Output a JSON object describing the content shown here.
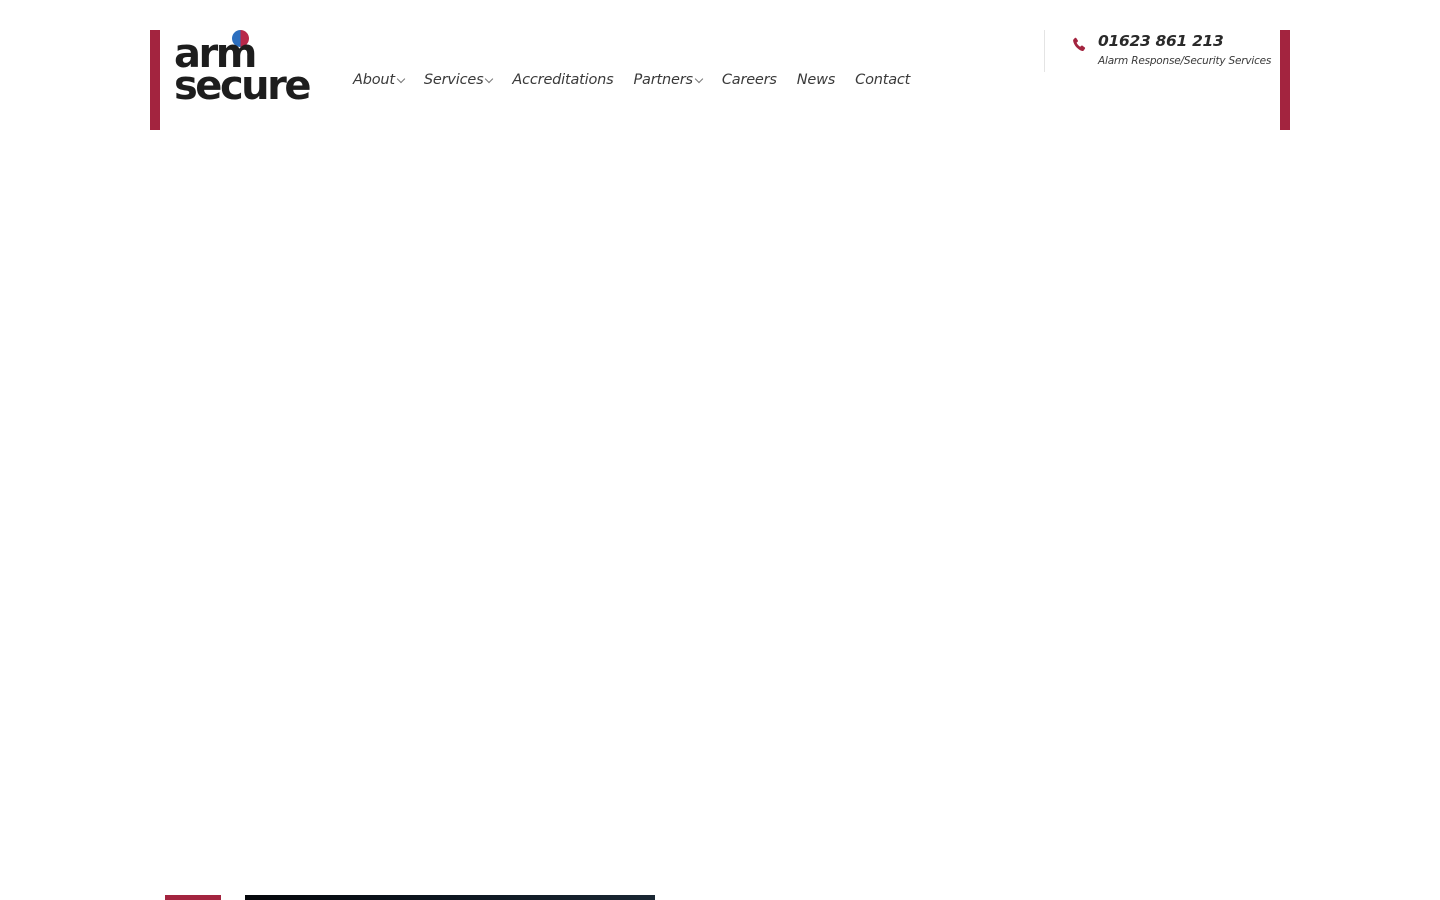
{
  "brand": {
    "logo_line1": "arm",
    "logo_line2": "secure",
    "accent_color": "#a3243f",
    "dot_colors": [
      "#2d6fbf",
      "#b8284a"
    ]
  },
  "nav": {
    "items": [
      {
        "label": "About",
        "has_dropdown": true
      },
      {
        "label": "Services",
        "has_dropdown": true
      },
      {
        "label": "Accreditations",
        "has_dropdown": false
      },
      {
        "label": "Partners",
        "has_dropdown": true
      },
      {
        "label": "Careers",
        "has_dropdown": false
      },
      {
        "label": "News",
        "has_dropdown": false
      },
      {
        "label": "Contact",
        "has_dropdown": false
      }
    ]
  },
  "contact": {
    "icon": "phone-icon",
    "phone": "01623 861 213",
    "subtitle": "Alarm Response/Security Services"
  }
}
